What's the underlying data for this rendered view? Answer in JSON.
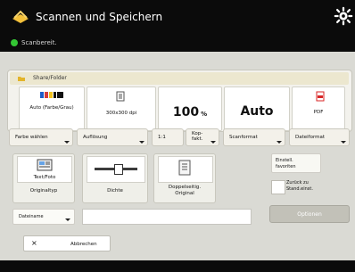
{
  "app": {
    "title": "Scannen und Speichern",
    "status": "Scanbereit."
  },
  "panel": {
    "location": "Share/Folder"
  },
  "settings": {
    "color": "Auto (Farbe/Grau)",
    "resolution": "300x300 dpi",
    "zoom_value": "100",
    "zoom_unit": "%",
    "size": "Auto",
    "format": "PDF"
  },
  "buttons": {
    "color": "Farbe wählen",
    "resolution": "Auflösung",
    "ratio": "1:1",
    "copy_ratio": "Kop-\nfakt.",
    "scan_size": "Scanformat",
    "file_format": "Dateiformat"
  },
  "lower": {
    "original_type_label": "Text/Foto",
    "original_type": "Originaltyp",
    "density": "Dichte",
    "duplex": "Doppelseitig.\nOriginal",
    "default_setting": "Einstell.\nfavoriten",
    "restore_default": "Zurück zu\nStand.einst.",
    "filename_label": "Dateiname",
    "options": "Optionen",
    "cancel": "Abbrechen"
  },
  "colors": {
    "accent": "#f2b225",
    "ready": "#34c634",
    "pdf": "#d82626"
  }
}
